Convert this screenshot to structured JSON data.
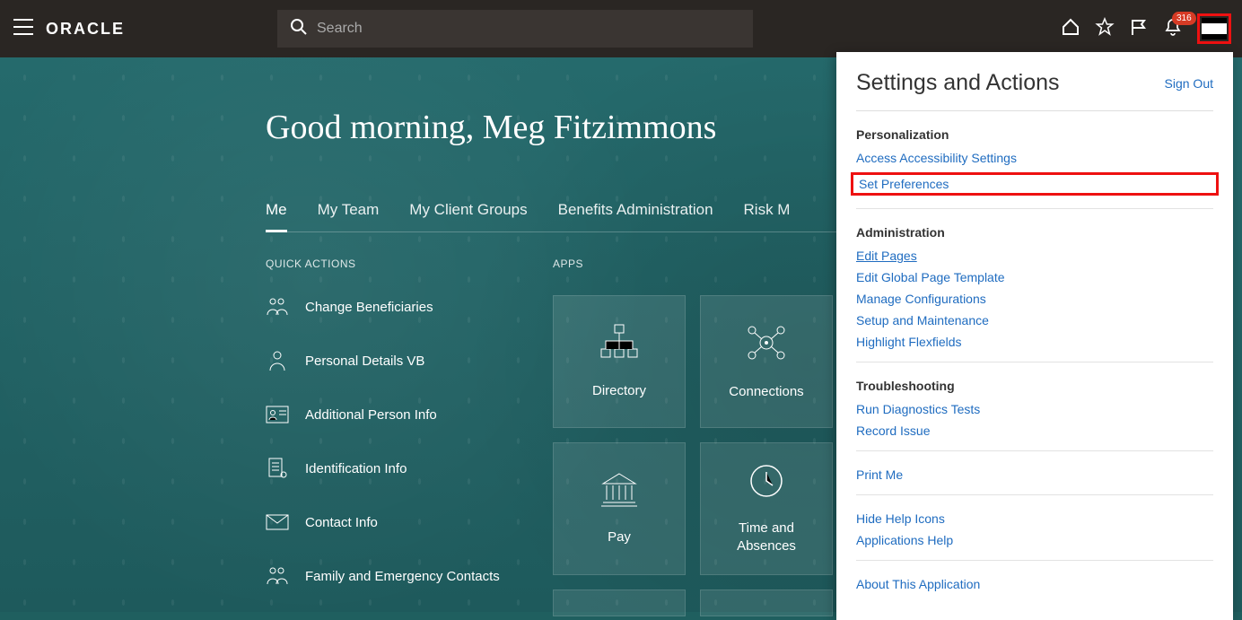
{
  "header": {
    "logo": "ORACLE",
    "search_placeholder": "Search",
    "notification_count": "316"
  },
  "greeting": "Good morning, Meg Fitzimmons",
  "tabs": [
    {
      "label": "Me",
      "active": true
    },
    {
      "label": "My Team"
    },
    {
      "label": "My Client Groups"
    },
    {
      "label": "Benefits Administration"
    },
    {
      "label": "Risk M"
    }
  ],
  "quick_actions_header": "QUICK ACTIONS",
  "quick_actions": [
    {
      "icon": "people",
      "label": "Change Beneficiaries"
    },
    {
      "icon": "person",
      "label": "Personal Details VB"
    },
    {
      "icon": "card",
      "label": "Additional Person Info"
    },
    {
      "icon": "doc",
      "label": "Identification Info"
    },
    {
      "icon": "mail",
      "label": "Contact Info"
    },
    {
      "icon": "people",
      "label": "Family and Emergency Contacts"
    }
  ],
  "apps_header": "APPS",
  "apps_row1": [
    {
      "icon": "org",
      "label": "Directory"
    },
    {
      "icon": "net",
      "label": "Connections"
    }
  ],
  "apps_row2": [
    {
      "icon": "bank",
      "label": "Pay"
    },
    {
      "icon": "clock",
      "label": "Time and Absences"
    }
  ],
  "panel": {
    "title": "Settings and Actions",
    "signout": "Sign Out",
    "groups": [
      {
        "title": "Personalization",
        "links": [
          {
            "label": "Access Accessibility Settings"
          },
          {
            "label": "Set Preferences",
            "highlight": true
          }
        ]
      },
      {
        "title": "Administration",
        "links": [
          {
            "label": "Edit Pages",
            "underline": true
          },
          {
            "label": "Edit Global Page Template"
          },
          {
            "label": "Manage Configurations"
          },
          {
            "label": "Setup and Maintenance"
          },
          {
            "label": "Highlight Flexfields"
          }
        ]
      },
      {
        "title": "Troubleshooting",
        "links": [
          {
            "label": "Run Diagnostics Tests"
          },
          {
            "label": "Record Issue"
          }
        ]
      }
    ],
    "extra_links": [
      "Print Me",
      "Hide Help Icons",
      "Applications Help",
      "About This Application"
    ]
  }
}
